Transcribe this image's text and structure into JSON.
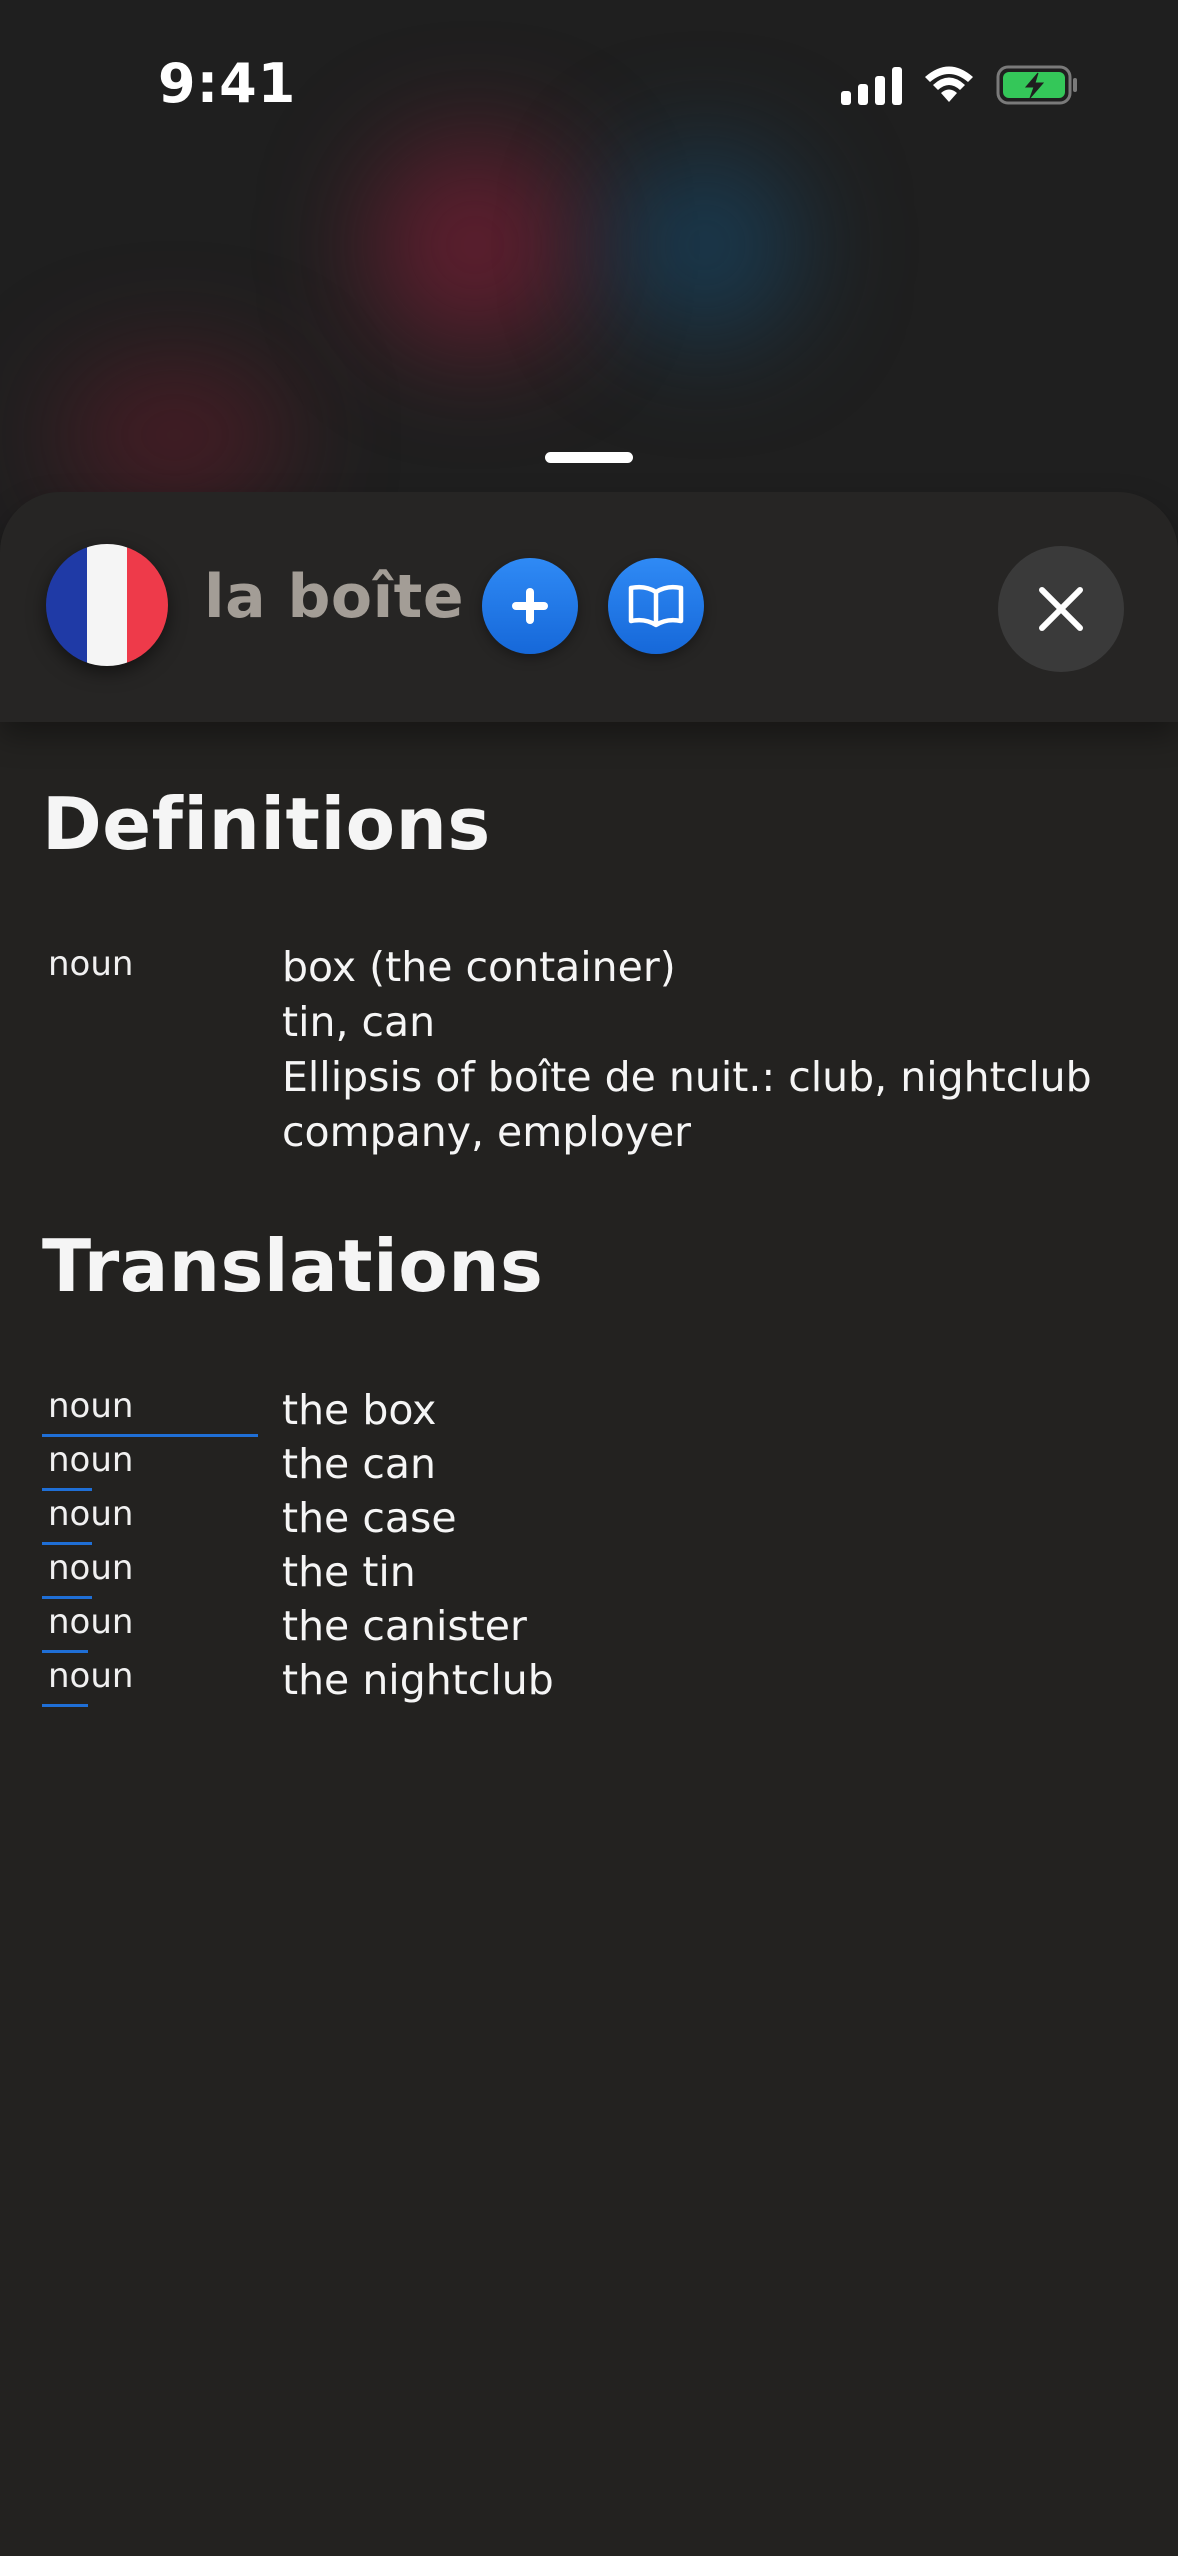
{
  "status_bar": {
    "time": "9:41"
  },
  "sheet": {
    "flag_country": "France",
    "word": "la boîte",
    "buttons": {
      "add_icon": "plus-icon",
      "dictionary_icon": "book-open-icon",
      "close_icon": "close-icon"
    }
  },
  "definitions": {
    "title": "Definitions",
    "groups": [
      {
        "pos": "noun",
        "lines": [
          "box (the container)",
          "tin, can",
          "Ellipsis of boîte de nuit.: club, nightclub",
          "company, employer"
        ]
      }
    ]
  },
  "translations": {
    "title": "Translations",
    "items": [
      {
        "pos": "noun",
        "text": "the box"
      },
      {
        "pos": "noun",
        "text": "the can"
      },
      {
        "pos": "noun",
        "text": "the case"
      },
      {
        "pos": "noun",
        "text": "the tin"
      },
      {
        "pos": "noun",
        "text": "the canister"
      },
      {
        "pos": "noun",
        "text": "the nightclub"
      }
    ]
  },
  "colors": {
    "accent_blue": "#1f6fd6",
    "background": "#232220",
    "flag_blue": "#1f3aa6",
    "flag_red": "#ee3a4a"
  }
}
